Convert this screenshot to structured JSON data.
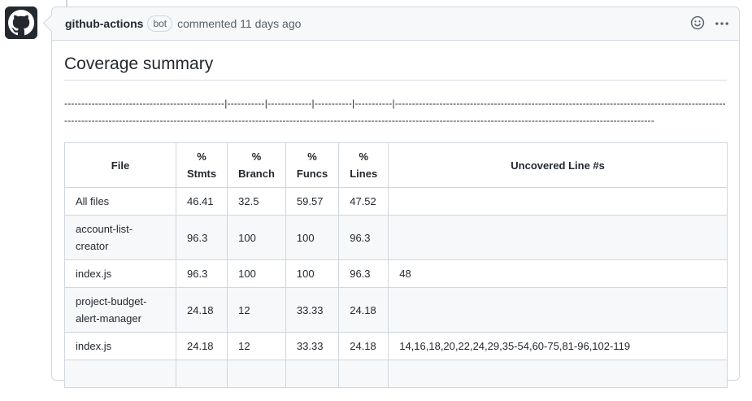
{
  "comment": {
    "author": "github-actions",
    "badge": "bot",
    "meta": "commented 11 days ago",
    "reaction_icon": "smiley-icon",
    "menu_icon": "kebab-horizontal-icon"
  },
  "body": {
    "title": "Coverage summary",
    "dash_line": "-----------------------------------------------|-----------|-------------|-----------|-----------|------------------------------------------------------------------------------------------------------------------------------------------------------------------------------------------------------------------------------------------------------------------------------",
    "table": {
      "headers": {
        "file": "File",
        "stmts_1": "%",
        "stmts_2": "Stmts",
        "branch_1": "%",
        "branch_2": "Branch",
        "funcs_1": "%",
        "funcs_2": "Funcs",
        "lines_1": "%",
        "lines_2": "Lines",
        "uncovered": "Uncovered Line #s"
      },
      "rows": [
        [
          "All files",
          "46.41",
          "32.5",
          "59.57",
          "47.52",
          ""
        ],
        [
          "account-list-creator",
          "96.3",
          "100",
          "100",
          "96.3",
          ""
        ],
        [
          "index.js",
          "96.3",
          "100",
          "100",
          "96.3",
          "48"
        ],
        [
          "project-budget-alert-manager",
          "24.18",
          "12",
          "33.33",
          "24.18",
          ""
        ],
        [
          "index.js",
          "24.18",
          "12",
          "33.33",
          "24.18",
          "14,16,18,20,22,24,29,35-54,60-75,81-96,102-119"
        ],
        [
          "",
          "",
          "",
          "",
          "",
          ""
        ]
      ]
    }
  }
}
